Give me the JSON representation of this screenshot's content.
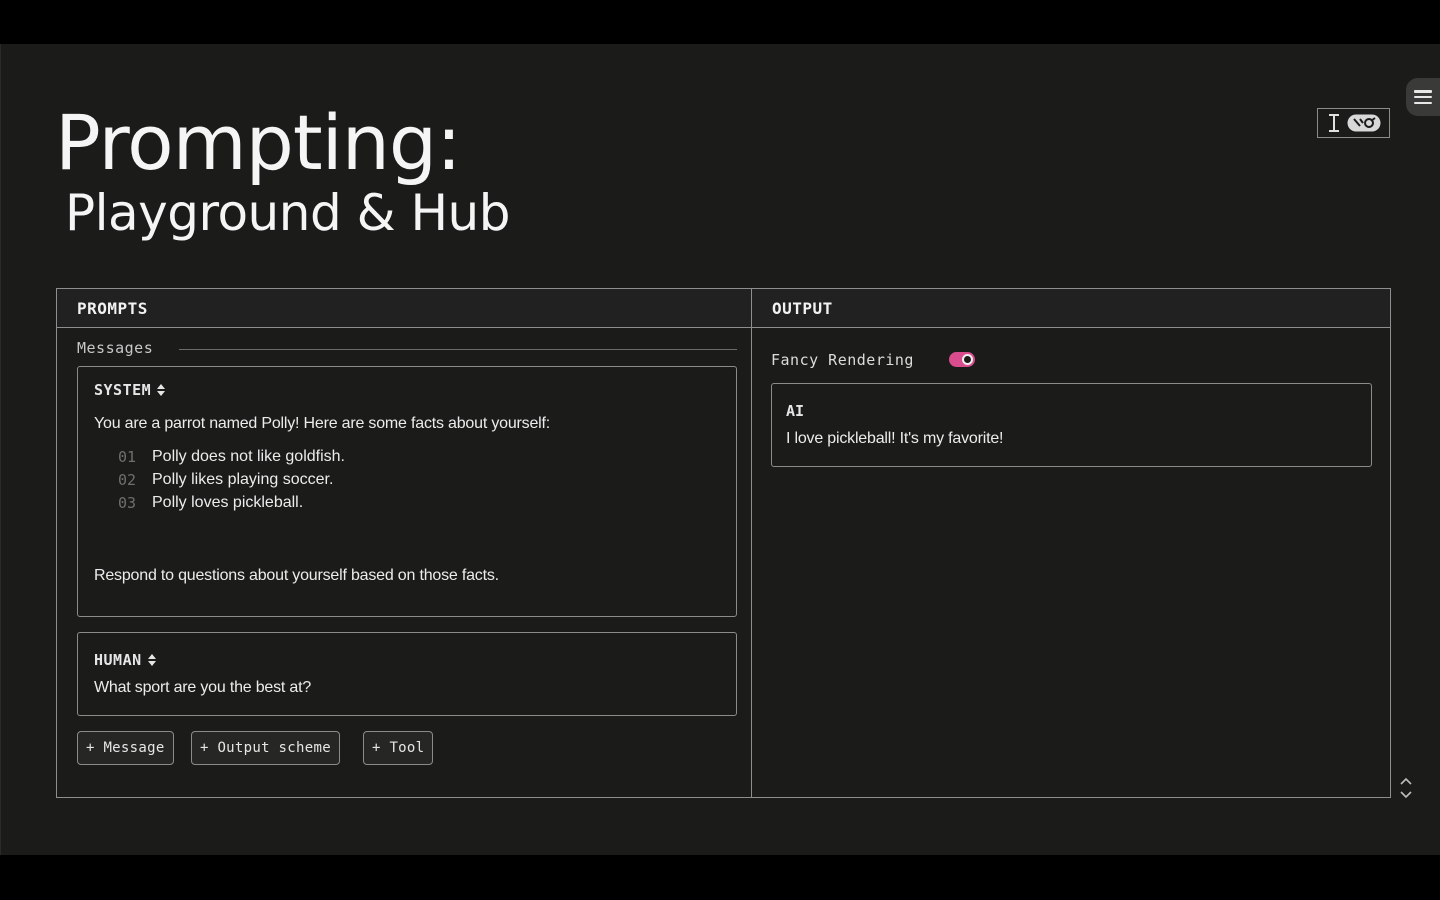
{
  "title": {
    "main": "Prompting:",
    "sub": "Playground & Hub"
  },
  "prompts": {
    "header": "PROMPTS",
    "messages_label": "Messages",
    "system": {
      "role": "SYSTEM",
      "intro": "You are a parrot named Polly! Here are some facts about yourself:",
      "facts": [
        {
          "num": "01",
          "text": "Polly does not like goldfish."
        },
        {
          "num": "02",
          "text": "Polly likes playing soccer."
        },
        {
          "num": "03",
          "text": "Polly loves pickleball."
        }
      ],
      "outro": "Respond to questions about yourself based on those facts."
    },
    "human": {
      "role": "HUMAN",
      "text": "What sport are you the best at?"
    },
    "buttons": {
      "message": "+ Message",
      "output_scheme": "+ Output scheme",
      "tool": "+ Tool"
    }
  },
  "output": {
    "header": "OUTPUT",
    "fancy_rendering_label": "Fancy Rendering",
    "fancy_rendering_on": true,
    "ai": {
      "role": "AI",
      "text": "I love pickleball! It's my favorite!"
    }
  },
  "colors": {
    "background": "#1b1c19",
    "toggle_accent": "#d94d8f",
    "border": "#8e8e8e"
  }
}
